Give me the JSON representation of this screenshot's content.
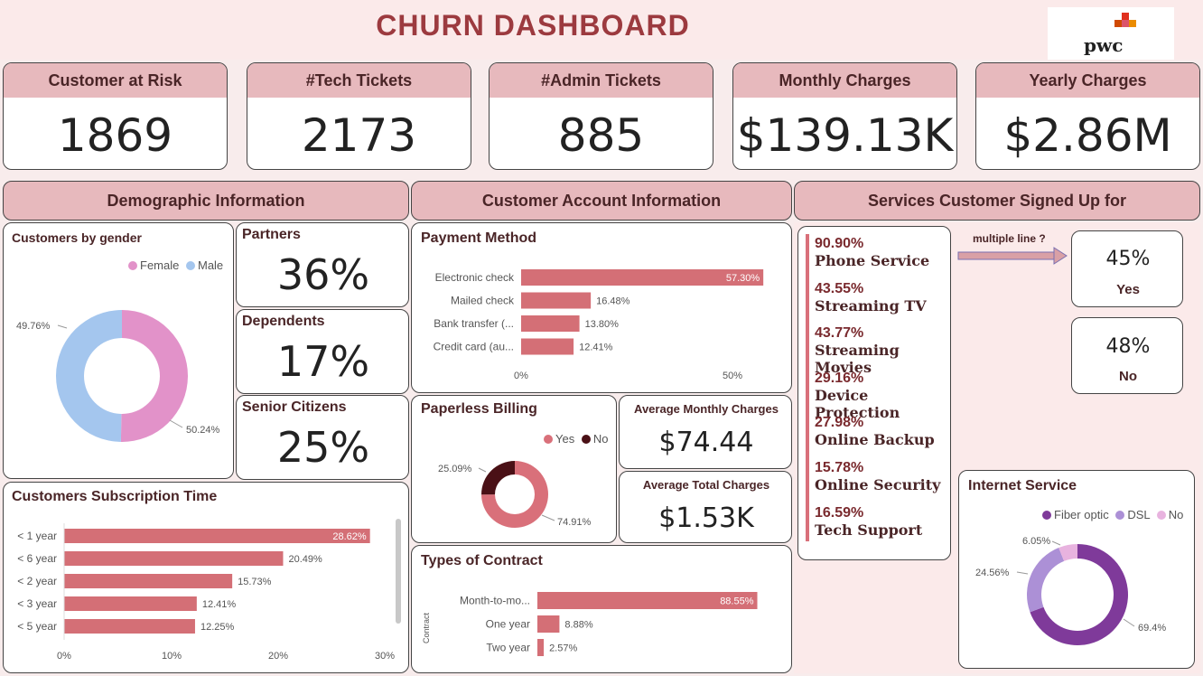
{
  "header": {
    "title": "CHURN  DASHBOARD",
    "logo": "pwc"
  },
  "kpis": [
    {
      "label": "Customer at Risk",
      "value": "1869"
    },
    {
      "label": "#Tech Tickets",
      "value": "2173"
    },
    {
      "label": "#Admin Tickets",
      "value": "885"
    },
    {
      "label": "Monthly Charges",
      "value": "$139.13K"
    },
    {
      "label": "Yearly Charges",
      "value": "$2.86M"
    }
  ],
  "sections": {
    "demographic": "Demographic  Information",
    "account": "Customer Account Information",
    "services": "Services Customer Signed Up for"
  },
  "gender": {
    "title": "Customers by gender",
    "legend": [
      "Female",
      "Male"
    ],
    "colors": {
      "female": "#e292c9",
      "male": "#a4c6ee"
    },
    "female_label": "50.24%",
    "male_label": "49.76%"
  },
  "partners": {
    "label": "Partners",
    "value": "36%"
  },
  "dependents": {
    "label": "Dependents",
    "value": "17%"
  },
  "seniors": {
    "label": "Senior Citizens",
    "value": "25%"
  },
  "subscription": {
    "title": "Customers Subscription Time",
    "ticks": [
      "0%",
      "10%",
      "20%",
      "30%"
    ]
  },
  "payment": {
    "title": "Payment Method",
    "ticks": [
      "0%",
      "50%"
    ]
  },
  "paperless": {
    "title": "Paperless Billing",
    "legend": [
      "Yes",
      "No"
    ],
    "colors": {
      "yes": "#d9707a",
      "no": "#4a1016"
    },
    "yes_label": "74.91%",
    "no_label": "25.09%"
  },
  "avg_monthly": {
    "label": "Average Monthly Charges",
    "value": "$74.44"
  },
  "avg_total": {
    "label": "Average Total Charges",
    "value": "$1.53K"
  },
  "contract": {
    "title": "Types of Contract",
    "axis_label": "Contract"
  },
  "services": [
    {
      "pct": "90.90%",
      "name": "Phone Service"
    },
    {
      "pct": "43.55%",
      "name": "Streaming TV"
    },
    {
      "pct": "43.77%",
      "name": "Streaming Movies"
    },
    {
      "pct": "29.16%",
      "name": "Device Protection"
    },
    {
      "pct": "27.98%",
      "name": "Online Backup"
    },
    {
      "pct": "15.78%",
      "name": "Online Security"
    },
    {
      "pct": "16.59%",
      "name": "Tech Support"
    }
  ],
  "multiple_line": {
    "label": "multiple line ?",
    "yes_value": "45%",
    "yes_label": "Yes",
    "no_value": "48%",
    "no_label": "No"
  },
  "internet": {
    "title": "Internet Service",
    "legend": [
      "Fiber optic",
      "DSL",
      "No"
    ],
    "colors": {
      "fiber": "#7f3a9a",
      "dsl": "#ac90d6",
      "no": "#e8b3df"
    },
    "fiber_label": "69.4%",
    "dsl_label": "24.56%",
    "no_label": "6.05%"
  },
  "chart_data": [
    {
      "type": "pie",
      "title": "Customers by gender",
      "categories": [
        "Female",
        "Male"
      ],
      "values": [
        50.24,
        49.76
      ]
    },
    {
      "type": "bar",
      "title": "Customers Subscription Time",
      "categories": [
        "< 1 year",
        "< 6 year",
        "< 2 year",
        "< 3 year",
        "< 5 year"
      ],
      "values": [
        28.62,
        20.49,
        15.73,
        12.41,
        12.25
      ],
      "labels": [
        "28.62%",
        "20.49%",
        "15.73%",
        "12.41%",
        "12.25%"
      ],
      "xlim": [
        0,
        30
      ]
    },
    {
      "type": "bar",
      "title": "Payment Method",
      "categories": [
        "Electronic check",
        "Mailed check",
        "Bank transfer (...",
        "Credit card (au..."
      ],
      "values": [
        57.3,
        16.48,
        13.8,
        12.41
      ],
      "labels": [
        "57.30%",
        "16.48%",
        "13.80%",
        "12.41%"
      ],
      "xlim": [
        0,
        50
      ]
    },
    {
      "type": "pie",
      "title": "Paperless Billing",
      "categories": [
        "Yes",
        "No"
      ],
      "values": [
        74.91,
        25.09
      ]
    },
    {
      "type": "bar",
      "title": "Types of Contract",
      "categories": [
        "Month-to-mo...",
        "One year",
        "Two year"
      ],
      "values": [
        88.55,
        8.88,
        2.57
      ],
      "labels": [
        "88.55%",
        "8.88%",
        "2.57%"
      ],
      "ylabel": "Contract"
    },
    {
      "type": "pie",
      "title": "Internet Service",
      "categories": [
        "Fiber optic",
        "DSL",
        "No"
      ],
      "values": [
        69.4,
        24.56,
        6.05
      ]
    }
  ]
}
